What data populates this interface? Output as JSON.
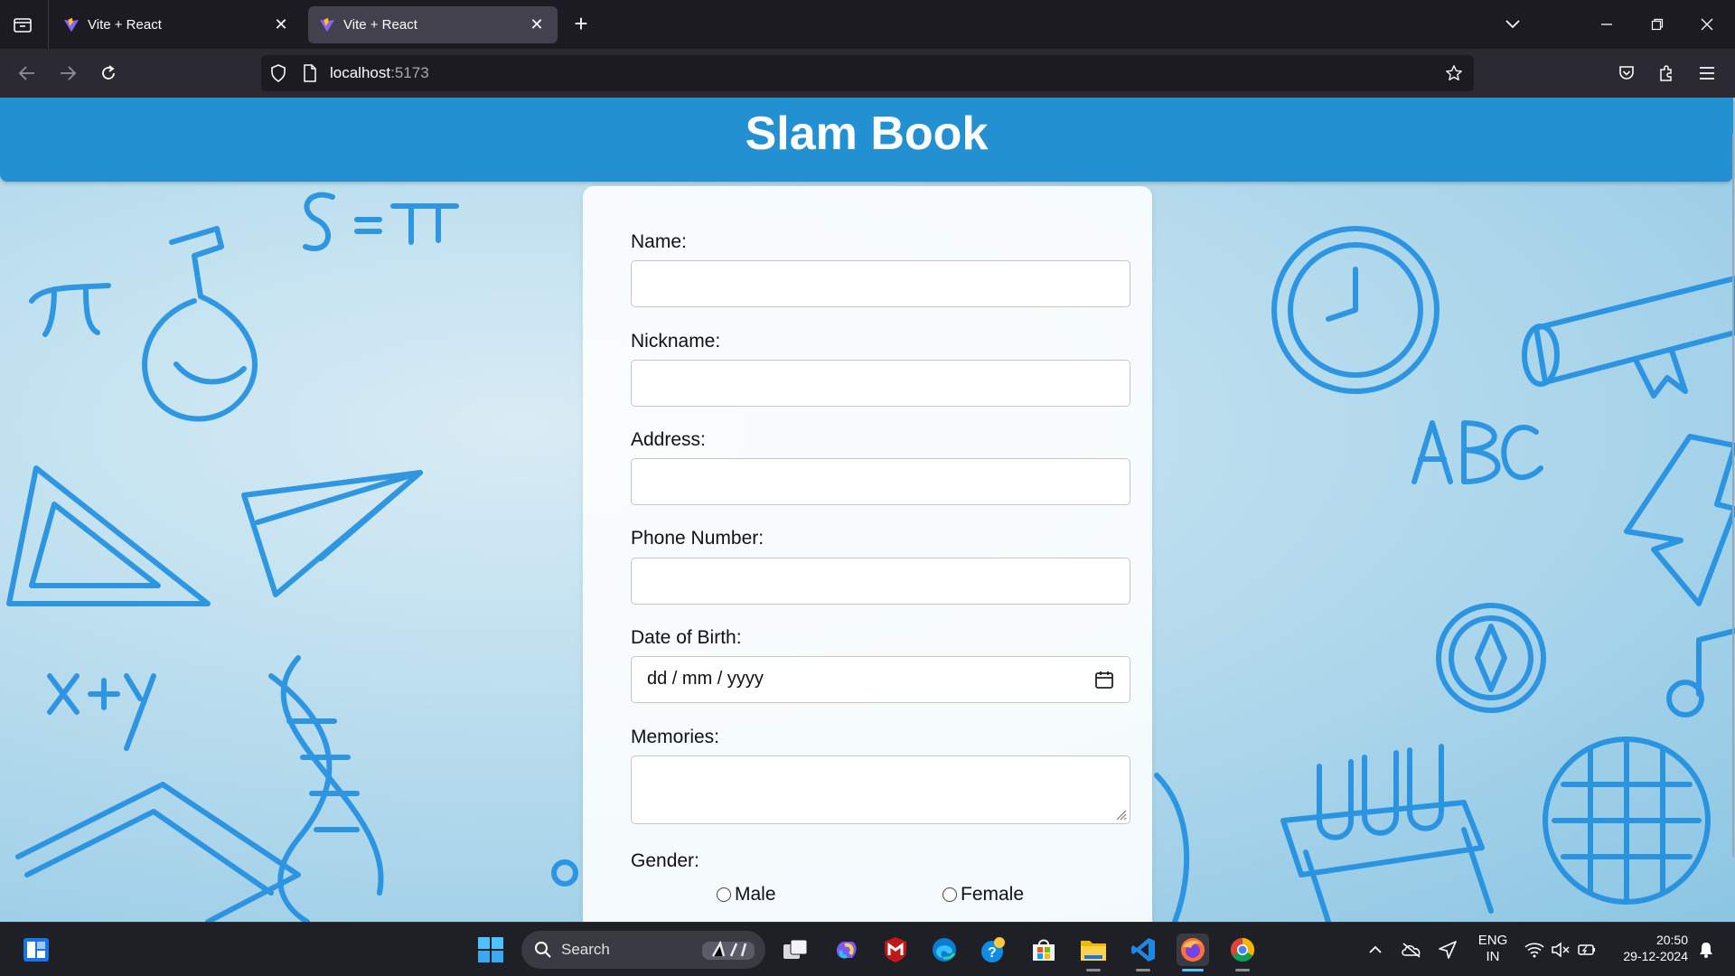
{
  "browser": {
    "tabs": [
      {
        "title": "Vite + React",
        "active": false
      },
      {
        "title": "Vite + React",
        "active": true
      }
    ],
    "url": {
      "host": "localhost",
      "port": ":5173"
    }
  },
  "page": {
    "title": "Slam Book",
    "form": {
      "name_label": "Name:",
      "nickname_label": "Nickname:",
      "address_label": "Address:",
      "phone_label": "Phone Number:",
      "dob_label": "Date of Birth:",
      "dob_placeholder": "dd / mm / yyyy",
      "memories_label": "Memories:",
      "gender_label": "Gender:",
      "gender_options": [
        "Male",
        "Female"
      ]
    },
    "colors": {
      "header": "#2290d1",
      "doodle": "#1f8ee0"
    }
  },
  "taskbar": {
    "search_label": "Search",
    "lang": "ENG",
    "region": "IN",
    "time": "20:50",
    "date": "29-12-2024"
  }
}
